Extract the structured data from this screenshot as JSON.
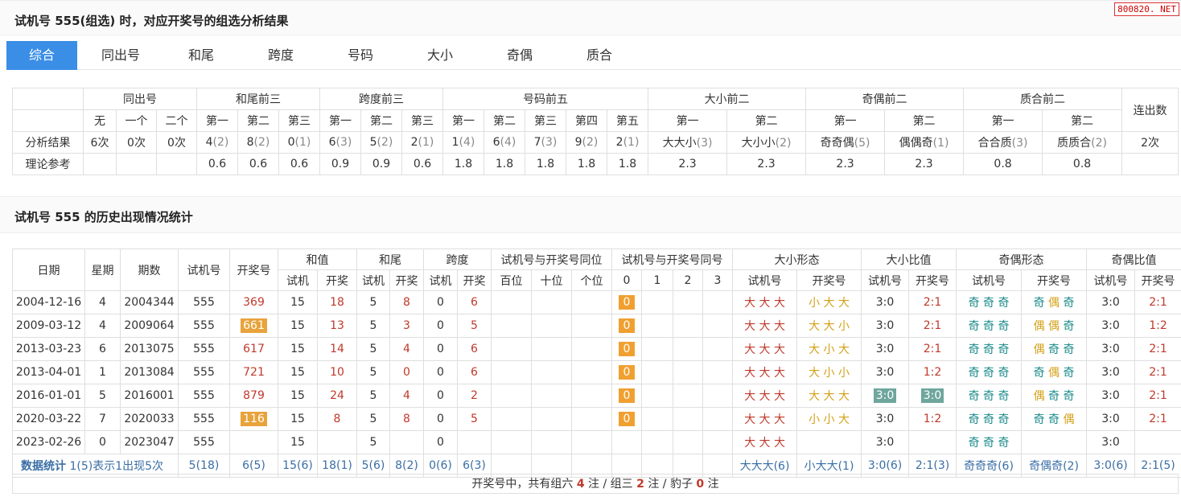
{
  "title": "试机号 555(组选) 时，对应开奖号的组选分析结果",
  "badge": "800820. NET",
  "tabs": [
    "综合",
    "同出号",
    "和尾",
    "跨度",
    "号码",
    "大小",
    "奇偶",
    "质合"
  ],
  "analysis": {
    "groups": [
      "同出号",
      "和尾前三",
      "跨度前三",
      "号码前五",
      "大小前二",
      "奇偶前二",
      "质合前二",
      "连出数"
    ],
    "subheaders": [
      "无",
      "一个",
      "二个",
      "第一",
      "第二",
      "第三",
      "第一",
      "第二",
      "第三",
      "第一",
      "第二",
      "第三",
      "第四",
      "第五",
      "第一",
      "第二",
      "第一",
      "第二",
      "第一",
      "第二"
    ],
    "row_result_label": "分析结果",
    "row_ref_label": "理论参考",
    "result": [
      [
        "6次",
        ""
      ],
      [
        "0次",
        ""
      ],
      [
        "0次",
        ""
      ],
      [
        "4",
        "(2)"
      ],
      [
        "8",
        "(2)"
      ],
      [
        "0",
        "(1)"
      ],
      [
        "6",
        "(3)"
      ],
      [
        "5",
        "(2)"
      ],
      [
        "2",
        "(1)"
      ],
      [
        "1",
        "(4)"
      ],
      [
        "6",
        "(4)"
      ],
      [
        "7",
        "(3)"
      ],
      [
        "9",
        "(2)"
      ],
      [
        "2",
        "(1)"
      ],
      [
        "大大小",
        "(3)"
      ],
      [
        "大小小",
        "(2)"
      ],
      [
        "奇奇偶",
        "(5)"
      ],
      [
        "偶偶奇",
        "(1)"
      ],
      [
        "合合质",
        "(3)"
      ],
      [
        "质质合",
        "(2)"
      ],
      [
        "2次",
        ""
      ]
    ],
    "reference": [
      "",
      "",
      "",
      "0.6",
      "0.6",
      "0.6",
      "0.9",
      "0.9",
      "0.6",
      "1.8",
      "1.8",
      "1.8",
      "1.8",
      "1.8",
      "2.3",
      "2.3",
      "2.3",
      "2.3",
      "0.8",
      "0.8",
      ""
    ]
  },
  "history_title": "试机号 555 的历史出现情况统计",
  "history": {
    "headers_top": [
      "日期",
      "星期",
      "期数",
      "试机号",
      "开奖号",
      "和值",
      "和尾",
      "跨度",
      "试机号与开奖号同位",
      "试机号与开奖号同号",
      "大小形态",
      "大小比值",
      "奇偶形态",
      "奇偶比值"
    ],
    "headers_sub": [
      "试机",
      "开奖",
      "试机",
      "开奖",
      "试机",
      "开奖",
      "百位",
      "十位",
      "个位",
      "0",
      "1",
      "2",
      "3",
      "试机号",
      "开奖号",
      "试机号",
      "开奖号",
      "试机号",
      "开奖号",
      "试机号",
      "开奖号"
    ],
    "rows": [
      {
        "date": "2004-12-16",
        "week": "4",
        "issue": "2004344",
        "test": "555",
        "draw": "369",
        "draw_hl": false,
        "sum_t": "15",
        "sum_d": "18",
        "tail_t": "5",
        "tail_d": "8",
        "span_t": "0",
        "span_d": "6",
        "same": "0",
        "bs_t": "大 大 大",
        "bs_d": "小 大 大",
        "bsr_t": "3:0",
        "bsr_d": "2:1",
        "bsr_hl": false,
        "oe_t": "奇 奇 奇",
        "oe_d": [
          "奇",
          "偶",
          "奇"
        ],
        "oer_t": "3:0",
        "oer_d": "2:1"
      },
      {
        "date": "2009-03-12",
        "week": "4",
        "issue": "2009064",
        "test": "555",
        "draw": "661",
        "draw_hl": true,
        "sum_t": "15",
        "sum_d": "13",
        "tail_t": "5",
        "tail_d": "3",
        "span_t": "0",
        "span_d": "5",
        "same": "0",
        "bs_t": "大 大 大",
        "bs_d": "大 大 小",
        "bsr_t": "3:0",
        "bsr_d": "2:1",
        "bsr_hl": false,
        "oe_t": "奇 奇 奇",
        "oe_d": [
          "偶",
          "偶",
          "奇"
        ],
        "oer_t": "3:0",
        "oer_d": "1:2"
      },
      {
        "date": "2013-03-23",
        "week": "6",
        "issue": "2013075",
        "test": "555",
        "draw": "617",
        "draw_hl": false,
        "sum_t": "15",
        "sum_d": "14",
        "tail_t": "5",
        "tail_d": "4",
        "span_t": "0",
        "span_d": "6",
        "same": "0",
        "bs_t": "大 大 大",
        "bs_d": "大 小 大",
        "bsr_t": "3:0",
        "bsr_d": "2:1",
        "bsr_hl": false,
        "oe_t": "奇 奇 奇",
        "oe_d": [
          "偶",
          "奇",
          "奇"
        ],
        "oer_t": "3:0",
        "oer_d": "2:1"
      },
      {
        "date": "2013-04-01",
        "week": "1",
        "issue": "2013084",
        "test": "555",
        "draw": "721",
        "draw_hl": false,
        "sum_t": "15",
        "sum_d": "10",
        "tail_t": "5",
        "tail_d": "0",
        "span_t": "0",
        "span_d": "6",
        "same": "0",
        "bs_t": "大 大 大",
        "bs_d": "大 小 小",
        "bsr_t": "3:0",
        "bsr_d": "1:2",
        "bsr_hl": false,
        "oe_t": "奇 奇 奇",
        "oe_d": [
          "奇",
          "偶",
          "奇"
        ],
        "oer_t": "3:0",
        "oer_d": "2:1"
      },
      {
        "date": "2016-01-01",
        "week": "5",
        "issue": "2016001",
        "test": "555",
        "draw": "879",
        "draw_hl": false,
        "sum_t": "15",
        "sum_d": "24",
        "tail_t": "5",
        "tail_d": "4",
        "span_t": "0",
        "span_d": "2",
        "same": "0",
        "bs_t": "大 大 大",
        "bs_d": "大 大 大",
        "bsr_t": "3:0",
        "bsr_d": "3:0",
        "bsr_hl": true,
        "oe_t": "奇 奇 奇",
        "oe_d": [
          "偶",
          "奇",
          "奇"
        ],
        "oer_t": "3:0",
        "oer_d": "2:1"
      },
      {
        "date": "2020-03-22",
        "week": "7",
        "issue": "2020033",
        "test": "555",
        "draw": "116",
        "draw_hl": true,
        "sum_t": "15",
        "sum_d": "8",
        "tail_t": "5",
        "tail_d": "8",
        "span_t": "0",
        "span_d": "5",
        "same": "0",
        "bs_t": "大 大 大",
        "bs_d": "小 小 大",
        "bsr_t": "3:0",
        "bsr_d": "1:2",
        "bsr_hl": false,
        "oe_t": "奇 奇 奇",
        "oe_d": [
          "奇",
          "奇",
          "偶"
        ],
        "oer_t": "3:0",
        "oer_d": "2:1"
      },
      {
        "date": "2023-02-26",
        "week": "0",
        "issue": "2023047",
        "test": "555",
        "draw": "",
        "draw_hl": false,
        "sum_t": "15",
        "sum_d": "",
        "tail_t": "5",
        "tail_d": "",
        "span_t": "0",
        "span_d": "",
        "same": "",
        "bs_t": "大 大 大",
        "bs_d": "",
        "bsr_t": "3:0",
        "bsr_d": "",
        "bsr_hl": false,
        "oe_t": "奇 奇 奇",
        "oe_d": [],
        "oer_t": "3:0",
        "oer_d": ""
      }
    ],
    "stats": {
      "label_bold": "数据统计",
      "label_rest": " 1(5)表示1出现5次",
      "values": [
        "5(18)",
        "6(5)",
        "15(6)",
        "18(1)",
        "5(6)",
        "8(2)",
        "0(6)",
        "6(3)",
        "",
        "",
        "",
        "",
        "",
        "",
        "",
        "大大大(6)",
        "小大大(1)",
        "3:0(6)",
        "2:1(3)",
        "奇奇奇(6)",
        "奇偶奇(2)",
        "3:0(6)",
        "2:1(5)"
      ]
    }
  },
  "footer": {
    "pre": "开奖号中，共有组六",
    "g6": "4",
    "mid1": "注 / 组三",
    "g3": "2",
    "mid2": "注 / 豹子",
    "bz": "0",
    "post": "注"
  }
}
